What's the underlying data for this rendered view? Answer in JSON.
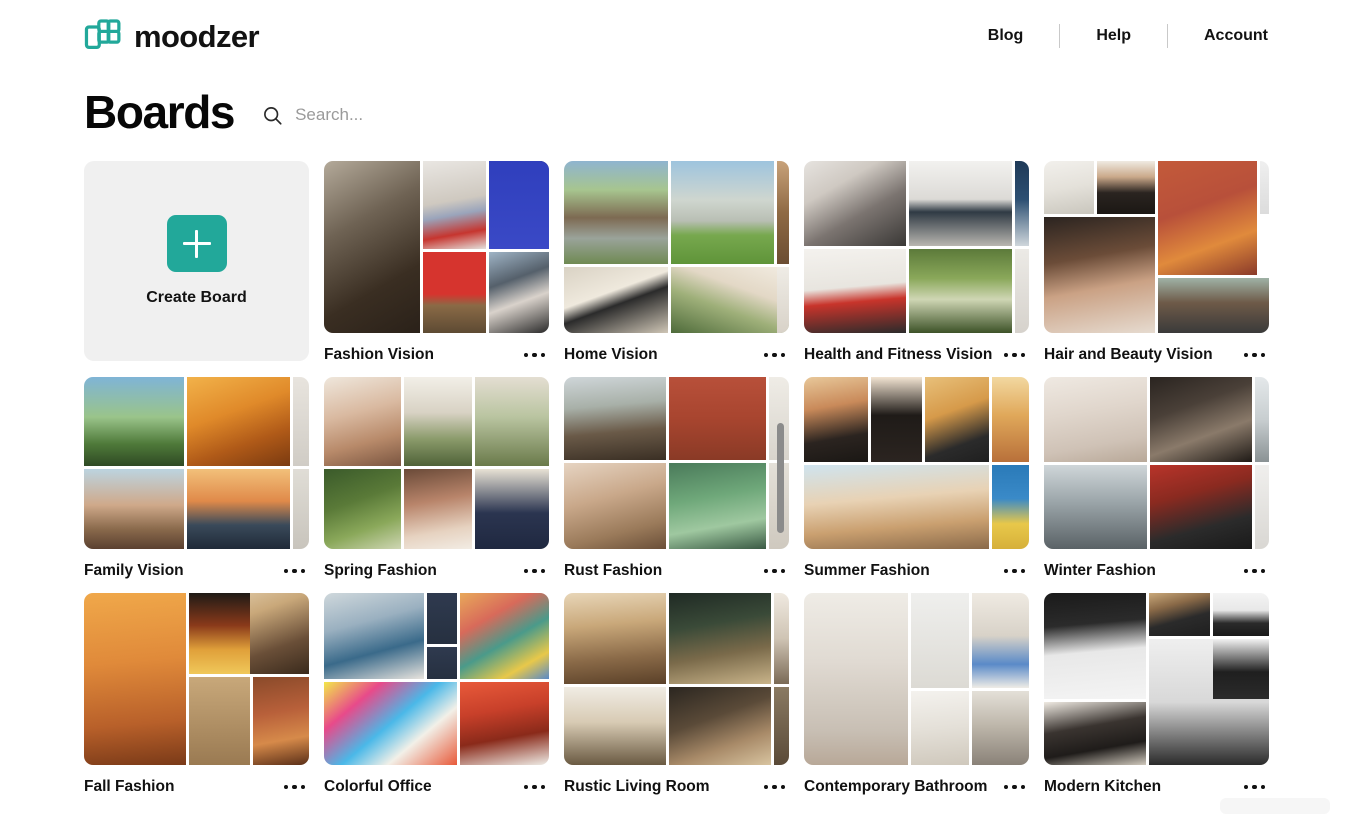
{
  "brand": {
    "name": "moodzer",
    "logo_icon": "moodzer-grid-logo",
    "accent_color": "#22a89a"
  },
  "header": {
    "nav": [
      {
        "label": "Blog",
        "name": "blog"
      },
      {
        "label": "Help",
        "name": "help"
      },
      {
        "label": "Account",
        "name": "account"
      }
    ]
  },
  "page": {
    "title": "Boards",
    "search": {
      "placeholder": "Search...",
      "value": "",
      "icon": "search-icon"
    }
  },
  "create_card": {
    "label": "Create Board",
    "icon": "plus-icon"
  },
  "boards": [
    {
      "title": "Fashion Vision",
      "menu_icon": "more-options-icon",
      "layout": "A",
      "scrollbar": false,
      "tiles": [
        "linear-gradient(150deg,#b4aa9a 0%,#6f6354 35%,#3a2e22 70%,#2a2119 100%)",
        "linear-gradient(170deg,#e9e6e2 0%,#cfc9c0 45%,#9aa4bb 60%,#c6352f 80%,#e3e0dc 100%)",
        "linear-gradient(135deg,#1b1b1b 0%,#2b2b2b 40%,#efefef 55%,#f4f4f4 100%)",
        "linear-gradient(180deg,#2f3fbd 0%,#3a49c6 100%)",
        "linear-gradient(180deg,#d6342e 0%,#d6342e 52%,#8a6a46 66%,#5d4a33 100%)",
        "linear-gradient(160deg,#9fb4c6 0%,#55606b 35%,#d9d2cb 60%,#2a2a2a 100%)"
      ]
    },
    {
      "title": "Home Vision",
      "menu_icon": "more-options-icon",
      "layout": "B",
      "scrollbar": false,
      "tiles": [
        "linear-gradient(180deg,#8fb4cf 0%,#a7c58f 28%,#7d6a52 55%,#9aa39a 75%,#6f8a52 100%)",
        "linear-gradient(180deg,#9ec4de 0%,#cfd6cf 38%,#b9bfb4 58%,#77a84e 72%,#5f9439 100%)",
        "linear-gradient(160deg,#d9d2c4 0%,#efe9dd 40%,#2b2b2b 55%,#cfc6b6 100%)",
        "linear-gradient(200deg,#f2ece2 0%,#e3d8c6 35%,#9fb07a 60%,#4e6b3a 100%)",
        "linear-gradient(180deg,#c8a27a 0%,#8f6a44 50%,#6b4d32 100%)",
        "linear-gradient(180deg,#efece6 0%,#d8d2c8 100%)"
      ]
    },
    {
      "title": "Health and Fitness Vision",
      "menu_icon": "more-options-icon",
      "layout": "C",
      "scrollbar": false,
      "tiles": [
        "linear-gradient(150deg,#e6e3df 0%,#cfc9c2 30%,#7b7470 60%,#3a3836 100%)",
        "linear-gradient(180deg,#f2f1ef 0%,#dcdad6 45%,#2f3a44 60%,#b9b6b0 100%)",
        "linear-gradient(180deg,#1f3a58 0%,#2c4f72 45%,#cfd6db 100%)",
        "linear-gradient(175deg,#f4f2ee 0%,#e8e5df 45%,#c8342b 62%,#2b2b2b 100%)",
        "linear-gradient(180deg,#5c7a3a 0%,#8aa85a 35%,#cfd6b4 60%,#3d5228 100%)",
        "linear-gradient(180deg,#eceae6 0%,#d6d2cc 100%)"
      ]
    },
    {
      "title": "Hair and Beauty Vision",
      "menu_icon": "more-options-icon",
      "layout": "D",
      "scrollbar": false,
      "tiles": [
        "linear-gradient(170deg,#f2f0ec 0%,#e4e1da 50%,#c9c6bd 100%)",
        "linear-gradient(180deg,#efeae2 0%,#caa98a 30%,#2a2420 60%,#1b1714 100%)",
        "linear-gradient(160deg,#c35a3a 0%,#b8503a 40%,#e08a3c 70%,#8a3a2a 100%)",
        "linear-gradient(170deg,#2b2420 0%,#6b4c38 35%,#caa184 60%,#e6dbd0 100%)",
        "linear-gradient(180deg,#9fb2a6 0%,#6e5a48 45%,#3a3a3a 100%)",
        "linear-gradient(180deg,#efefef 0%,#dcdcdc 100%)"
      ]
    },
    {
      "title": "Family Vision",
      "menu_icon": "more-options-icon",
      "layout": "E",
      "scrollbar": false,
      "tiles": [
        "linear-gradient(180deg,#7fb4d6 0%,#9ac48a 45%,#4f7a3a 75%,#2f4a24 100%)",
        "linear-gradient(160deg,#f2b24a 0%,#e08a2a 40%,#b05a18 70%,#7a3a10 100%)",
        "linear-gradient(180deg,#bcd4e0 0%,#cfa98a 45%,#8a6a4c 75%,#5a4030 100%)",
        "linear-gradient(180deg,#f2c07a 0%,#e08a4a 40%,#3a4a5a 70%,#1f2a38 100%)",
        "linear-gradient(180deg,#e8e4de 0%,#d0ccc5 100%)",
        "linear-gradient(180deg,#e0ddd6 0%,#c8c4bc 100%)"
      ]
    },
    {
      "title": "Spring Fashion",
      "menu_icon": "more-options-icon",
      "layout": "F",
      "scrollbar": false,
      "tiles": [
        "linear-gradient(165deg,#efe7dc 0%,#d9b9a0 40%,#b88a6a 70%,#7a5540 100%)",
        "linear-gradient(180deg,#f2efe8 0%,#d8d2c4 40%,#8a9a6a 70%,#4f6238 100%)",
        "linear-gradient(180deg,#e4ded2 0%,#b9c4a0 45%,#6a7a4a 100%)",
        "linear-gradient(160deg,#3a5a2a 0%,#5a7a38 40%,#8aa85a 70%,#cfd6b4 100%)",
        "linear-gradient(170deg,#6a4a38 0%,#b8846a 40%,#e6d2c0 75%,#f2ece4 100%)",
        "linear-gradient(180deg,#e8e2d4 0%,#2b3550 55%,#1f2840 100%)"
      ]
    },
    {
      "title": "Rust Fashion",
      "menu_icon": "more-options-icon",
      "layout": "G",
      "scrollbar": true,
      "tiles": [
        "linear-gradient(175deg,#cfd6d9 0%,#a8b0a8 35%,#6a5a48 65%,#3a2f24 100%)",
        "linear-gradient(180deg,#b8503a 0%,#a8452f 50%,#8a3a26 100%)",
        "linear-gradient(165deg,#e6d4c2 0%,#c9a88a 40%,#9a7a5a 75%,#6a4f38 100%)",
        "linear-gradient(170deg,#4a7a5a 0%,#6fa87a 40%,#9fc8a0 70%,#3a5a44 100%)",
        "linear-gradient(180deg,#efece6 0%,#d8d4cc 100%)",
        "linear-gradient(180deg,#e4e0d8 0%,#cfc9bf 100%)"
      ]
    },
    {
      "title": "Summer Fashion",
      "menu_icon": "more-options-icon",
      "layout": "H",
      "scrollbar": false,
      "tiles": [
        "linear-gradient(170deg,#e8c89a 0%,#c98a5a 35%,#2b2420 70%,#1a1714 100%)",
        "linear-gradient(180deg,#f2e4d2 0%,#1f1b18 45%,#2b2420 100%)",
        "linear-gradient(160deg,#e8c07a 0%,#d69a4a 40%,#2b2b2b 75%,#1f1f1f 100%)",
        "linear-gradient(180deg,#f2d8a0 0%,#e0a85a 45%,#b8703a 100%)",
        "linear-gradient(175deg,#cfe4ef 0%,#e8d2b4 40%,#caa070 70%,#8a6a4a 100%)",
        "linear-gradient(180deg,#2a7ab8 0%,#3a8ac8 40%,#e8c84a 70%,#d6b03a 100%)"
      ]
    },
    {
      "title": "Winter Fashion",
      "menu_icon": "more-options-icon",
      "layout": "I",
      "scrollbar": false,
      "tiles": [
        "linear-gradient(170deg,#efe9e2 0%,#e0d6cc 40%,#cfc2b6 75%,#b8a898 100%)",
        "linear-gradient(160deg,#2a2420 0%,#4a4038 35%,#8a7a6a 65%,#1f1a16 100%)",
        "linear-gradient(180deg,#cfd6d9 0%,#9aa4a8 45%,#5a6266 100%)",
        "linear-gradient(165deg,#b8342a 0%,#8a2a20 35%,#2b2b2b 70%,#1a1a1a 100%)",
        "linear-gradient(180deg,#e4e8ea 0%,#c8ced0 50%,#8a9294 100%)",
        "linear-gradient(180deg,#f0efed 0%,#d9d7d3 100%)"
      ]
    },
    {
      "title": "Fall Fashion",
      "menu_icon": "more-options-icon",
      "layout": "J",
      "scrollbar": false,
      "tiles": [
        "linear-gradient(175deg,#f0a84a 0%,#e08a3a 40%,#b8602a 75%,#7a3a18 100%)",
        "linear-gradient(160deg,#e8d6b8 0%,#c9a87a 35%,#6a4f38 70%,#3a2a1c 100%)",
        "linear-gradient(180deg,#d8c8b0 0%,#a88a68 45%,#6a5038 100%)",
        "linear-gradient(170deg,#8a4a2a 0%,#b8603a 40%,#d68a4a 70%,#5a2f18 100%)",
        "linear-gradient(180deg,#1f1a16 0%,#8a3a1a 40%,#e0a03a 70%,#f0c85a 100%)",
        "linear-gradient(180deg,#c8a87a 0%,#9a7a52 100%)"
      ]
    },
    {
      "title": "Colorful Office",
      "menu_icon": "more-options-icon",
      "layout": "K",
      "scrollbar": false,
      "tiles": [
        "linear-gradient(165deg,#cfd8dc 0%,#9ab0c0 35%,#3a6a8a 65%,#e8e4de 100%)",
        "linear-gradient(180deg,#2f3a4f 0%,#263040 100%)",
        "linear-gradient(150deg,#e8a85a 0%,#d86a5a 30%,#4a9a8a 55%,#e8c84a 80%,#5a8ac8 100%)",
        "linear-gradient(180deg,#2f3a4f 0%,#263040 100%)",
        "linear-gradient(140deg,#f2e84a 0%,#e84a8a 25%,#4ab8e8 50%,#f2f0e8 70%,#e85a3a 100%)",
        "linear-gradient(170deg,#e85a3a 0%,#c8402a 35%,#8a2a1a 65%,#efece6 100%)"
      ]
    },
    {
      "title": "Rustic Living Room",
      "menu_icon": "more-options-icon",
      "layout": "L",
      "scrollbar": false,
      "tiles": [
        "linear-gradient(175deg,#e8d6b8 0%,#c9a87a 35%,#8a6a48 70%,#5a4028 100%)",
        "linear-gradient(170deg,#1f2a24 0%,#3a4a38 35%,#7a6a4a 65%,#c9b48a 100%)",
        "linear-gradient(180deg,#f0ece4 0%,#d8cbb4 45%,#6a5a42 100%)",
        "linear-gradient(160deg,#2b2620 0%,#5a4a38 40%,#a88a68 70%,#d8c4a0 100%)",
        "linear-gradient(180deg,#efe9e0 0%,#cfc4b4 50%,#7a6a56 100%)",
        "linear-gradient(180deg,#8a7a62 0%,#5a4a38 100%)"
      ]
    },
    {
      "title": "Contemporary Bathroom",
      "menu_icon": "more-options-icon",
      "layout": "M",
      "scrollbar": false,
      "tiles": [
        "linear-gradient(180deg,#efece6 0%,#e0dad2 40%,#c8bfb4 80%,#b8a898 100%)",
        "linear-gradient(160deg,#f2f0ec 0%,#d8342a 30%,#efece6 55%,#3a7a8a 80%,#e8e4de 100%)",
        "linear-gradient(180deg,#efeae2 0%,#d8d2c8 45%,#5a8ac8 75%,#efece6 100%)",
        "linear-gradient(175deg,#f4f2ee 0%,#e4e0d8 50%,#cfc8bc 100%)",
        "linear-gradient(180deg,#e4e0d8 0%,#bfb8ac 45%,#8a8278 100%)",
        "linear-gradient(180deg,#efefed 0%,#dcdad4 100%)"
      ]
    },
    {
      "title": "Modern Kitchen",
      "menu_icon": "more-options-icon",
      "layout": "N",
      "scrollbar": false,
      "tiles": [
        "linear-gradient(175deg,#1a1a1a 0%,#2b2b2b 30%,#e8e8e8 55%,#f4f4f4 100%)",
        "linear-gradient(165deg,#c9a87a 0%,#8a6a48 30%,#2b2b2b 60%,#1f1f1f 100%)",
        "linear-gradient(180deg,#f4f4f4 0%,#e8e8e8 40%,#2b2b2b 70%,#1a1a1a 100%)",
        "linear-gradient(180deg,#efefef 0%,#d8d8d8 50%,#2b2b2b 100%)",
        "linear-gradient(170deg,#efeae2 0%,#3a3430 40%,#1f1c1a 70%,#cfc8bc 100%)",
        "linear-gradient(180deg,#f2f2f2 0%,#1f1f1f 55%,#2b2b2b 100%)"
      ]
    }
  ]
}
